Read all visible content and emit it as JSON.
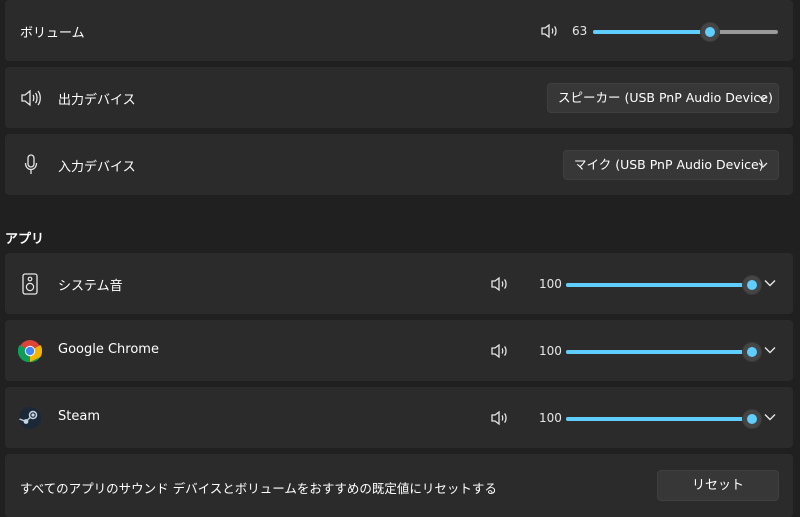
{
  "volume": {
    "label": "ボリューム",
    "value": "63",
    "level": 0.63,
    "icon": "speaker-icon"
  },
  "output": {
    "label": "出力デバイス",
    "selected": "スピーカー (USB PnP Audio Device)",
    "icon": "speaker-icon"
  },
  "input": {
    "label": "入力デバイス",
    "selected": "マイク (USB PnP Audio Device)",
    "icon": "microphone-icon"
  },
  "apps_section": {
    "title": "アプリ"
  },
  "apps": [
    {
      "name": "システム音",
      "value": "100",
      "level": 1.0,
      "icon": "speaker-box-icon"
    },
    {
      "name": "Google Chrome",
      "value": "100",
      "level": 1.0,
      "icon": "chrome-icon"
    },
    {
      "name": "Steam",
      "value": "100",
      "level": 1.0,
      "icon": "steam-icon"
    }
  ],
  "reset": {
    "description": "すべてのアプリのサウンド デバイスとボリュームをおすすめの既定値にリセットする",
    "button_label": "リセット"
  },
  "colors": {
    "accent": "#60cdff",
    "card": "#2b2b2b",
    "background": "#202020"
  }
}
